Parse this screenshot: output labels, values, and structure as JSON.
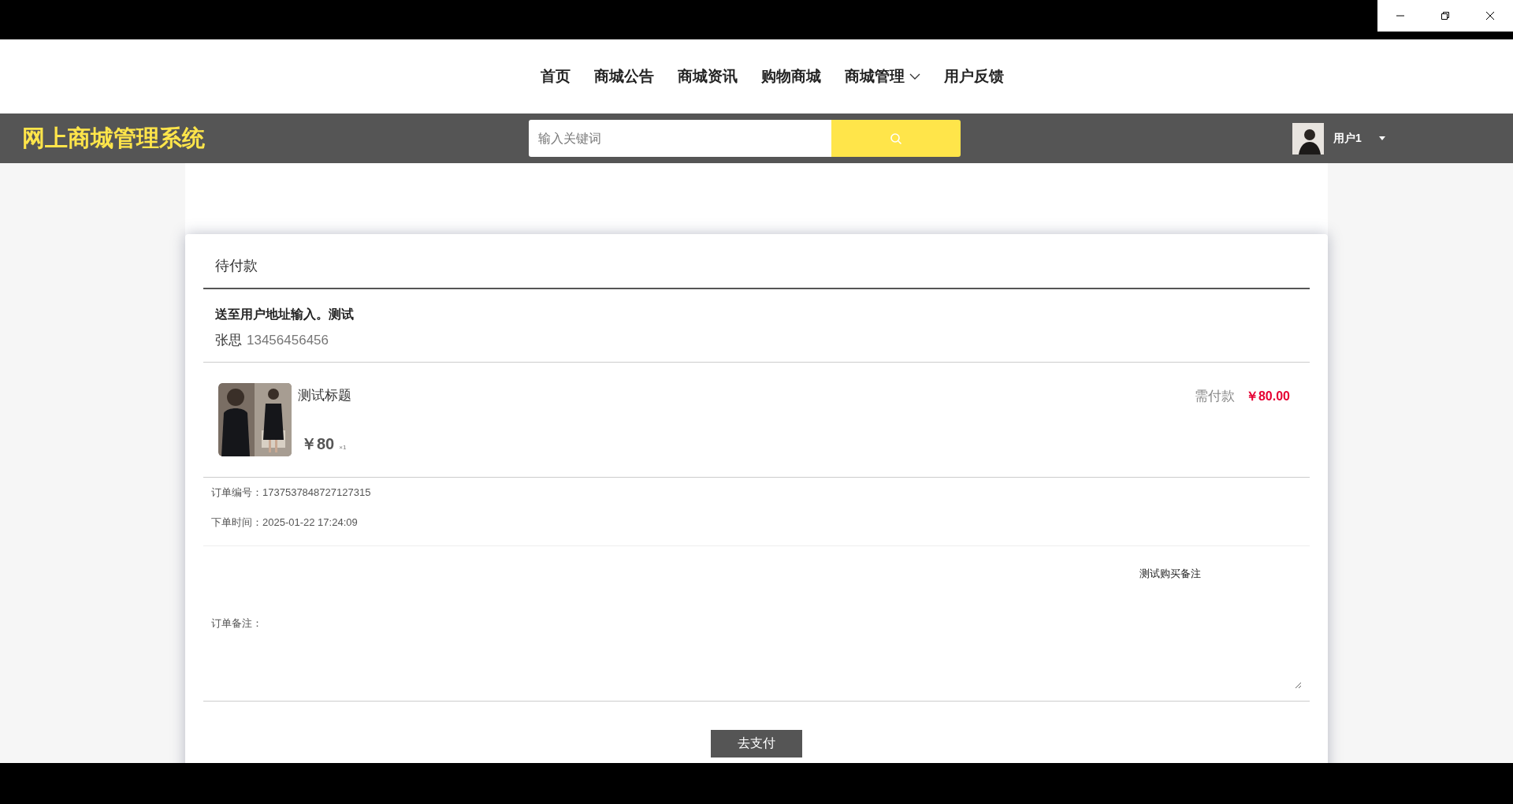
{
  "nav": [
    {
      "label": "首页",
      "has_menu": false
    },
    {
      "label": "商城公告",
      "has_menu": false
    },
    {
      "label": "商城资讯",
      "has_menu": false
    },
    {
      "label": "购物商城",
      "has_menu": false
    },
    {
      "label": "商城管理",
      "has_menu": true
    },
    {
      "label": "用户反馈",
      "has_menu": false
    }
  ],
  "header": {
    "logo": "网上商城管理系统",
    "search": {
      "placeholder": "输入关键词"
    },
    "user": "用户1"
  },
  "order": {
    "status": "待付款",
    "address": "送至用户地址输入。测试",
    "receiver": "张思",
    "phone": "13456456456",
    "item": {
      "title": "测试标题",
      "price": "￥80",
      "quantity": "×1",
      "kind": "picture"
    },
    "due_label": "需付款",
    "due_amount": "￥80.00",
    "info": [
      {
        "label": "订单编号：",
        "value": "1737537848727127315"
      },
      {
        "label": "下单时间：",
        "value": "2025-01-22 17:24:09"
      }
    ],
    "remark_label": "订单备注：",
    "remark": "测试购买备注",
    "pay_button": "去支付"
  }
}
